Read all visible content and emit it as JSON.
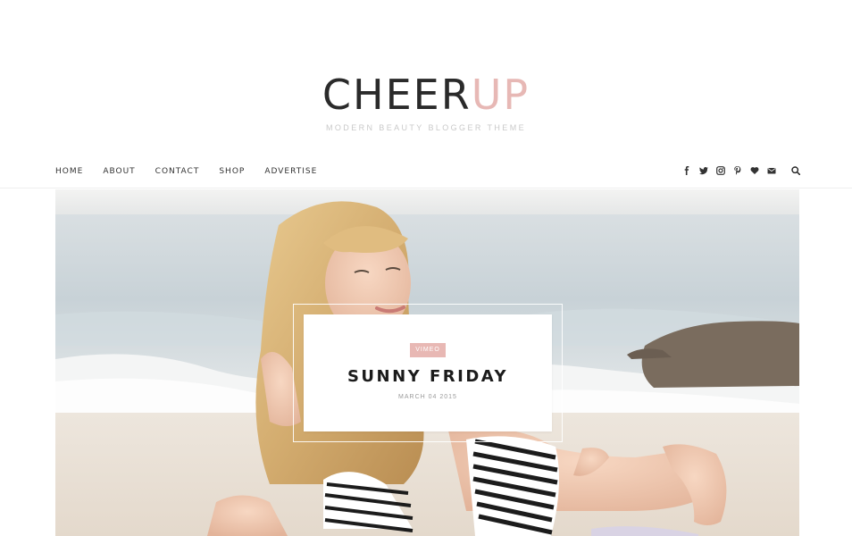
{
  "site": {
    "logo_part1": "CHEER",
    "logo_part2": "UP",
    "tagline": "MODERN BEAUTY BLOGGER THEME",
    "accent_color": "#e7b8b5"
  },
  "nav": {
    "items": [
      {
        "label": "HOME"
      },
      {
        "label": "ABOUT"
      },
      {
        "label": "CONTACT"
      },
      {
        "label": "SHOP"
      },
      {
        "label": "ADVERTISE"
      }
    ],
    "social_icons": [
      "facebook-icon",
      "twitter-icon",
      "instagram-icon",
      "pinterest-icon",
      "heart-icon",
      "email-icon"
    ],
    "search_icon": "search-icon"
  },
  "featured": {
    "category": "VIMEO",
    "title": "SUNNY FRIDAY",
    "date": "MARCH 04 2015"
  }
}
